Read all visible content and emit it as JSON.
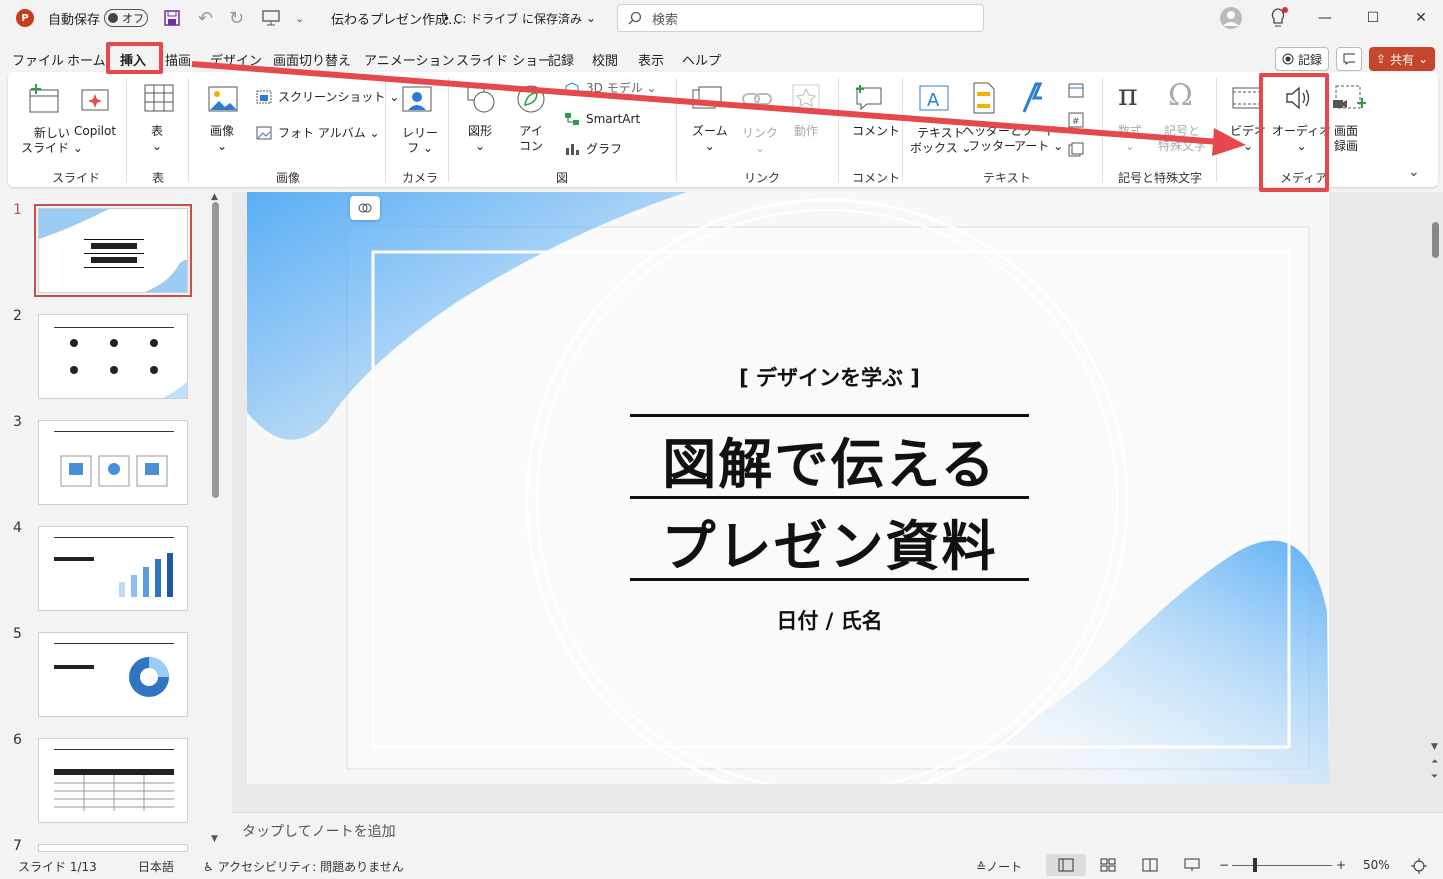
{
  "titlebar": {
    "autosave_label": "自動保存",
    "autosave_state": "オフ",
    "filename": "伝わるプレゼン作成…",
    "location": "• C: ドライブ に保存済み",
    "search_placeholder": "検索",
    "minimize": "—",
    "maximize": "☐",
    "close": "✕"
  },
  "menu": {
    "tabs": [
      "ファイル",
      "ホーム",
      "挿入",
      "描画",
      "デザイン",
      "画面切り替え",
      "アニメーション",
      "スライド ショー",
      "記録",
      "校閲",
      "表示",
      "ヘルプ"
    ],
    "record_button": "記録",
    "share_button": "共有"
  },
  "ribbon": {
    "new_slide": "新しい\nスライド ⌄",
    "copilot": "Copilot",
    "group_slides": "スライド",
    "table": "表",
    "group_table": "表",
    "image": "画像",
    "screenshot": "スクリーンショット ⌄",
    "photo_album": "フォト アルバム ⌄",
    "group_image": "画像",
    "cameo": "レリー\nフ ⌄",
    "group_camera": "カメラ",
    "shapes": "図形",
    "icons": "アイ\nコン",
    "model3d": "3D モデル ⌄",
    "smartart": "SmartArt",
    "chart": "グラフ",
    "group_figure": "図",
    "zoom": "ズーム",
    "link": "リンク",
    "action": "動作",
    "group_link": "リンク",
    "comment": "コメント",
    "group_comment": "コメント",
    "textbox": "テキスト\nボックス ⌄",
    "header_footer": "ヘッダーと\nフッター",
    "wordart": "ワード\nアート ⌄",
    "group_text": "テキスト",
    "equation": "数式",
    "symbol": "記号と\n特殊文字",
    "group_symbols": "記号と特殊文字",
    "video": "ビデオ",
    "audio": "オーディオ",
    "screen_recording": "画面\n録画",
    "group_media": "メディア"
  },
  "slides": [
    "1",
    "2",
    "3",
    "4",
    "5",
    "6",
    "7"
  ],
  "slide": {
    "kicker": "[ デザインを学ぶ ]",
    "title_line1": "図解で伝える",
    "title_line2": "プレゼン資料",
    "subtitle": "日付 / 氏名"
  },
  "notes_placeholder": "タップしてノートを追加",
  "status": {
    "slide_count": "スライド 1/13",
    "language": "日本語",
    "accessibility": "アクセシビリティ: 問題ありません",
    "notes": "ノート",
    "zoom": "50%"
  },
  "colors": {
    "accent_red": "#e5484d",
    "slide_blue": "#5aaef5"
  }
}
